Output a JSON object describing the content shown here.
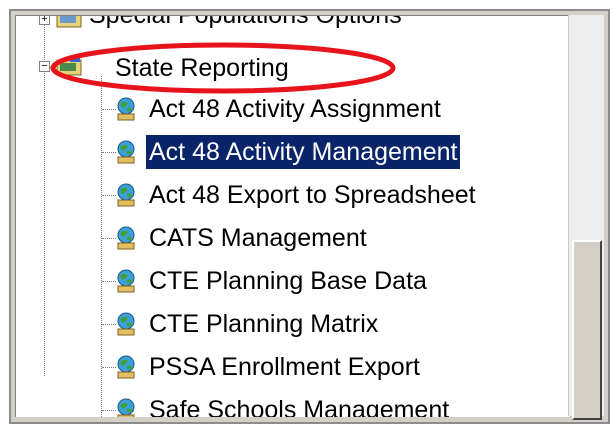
{
  "tree": {
    "partial_item": {
      "label": "Special Populations Options"
    },
    "group": {
      "label": "State Reporting",
      "expander": "−"
    },
    "items": [
      {
        "label": "Act 48 Activity Assignment",
        "selected": false
      },
      {
        "label": "Act 48 Activity Management",
        "selected": true
      },
      {
        "label": "Act 48 Export to Spreadsheet",
        "selected": false
      },
      {
        "label": "CATS Management",
        "selected": false
      },
      {
        "label": "CTE Planning Base Data",
        "selected": false
      },
      {
        "label": "CTE Planning Matrix",
        "selected": false
      },
      {
        "label": "PSSA Enrollment Export",
        "selected": false
      },
      {
        "label": "Safe Schools Management",
        "selected": false
      }
    ],
    "partial_expander": "+"
  },
  "icons": {
    "folder": "folder-icon",
    "item": "globe-person-icon"
  },
  "colors": {
    "selection_bg": "#0a246a",
    "selection_fg": "#ffffff",
    "highlight_ring": "#e8141c"
  }
}
